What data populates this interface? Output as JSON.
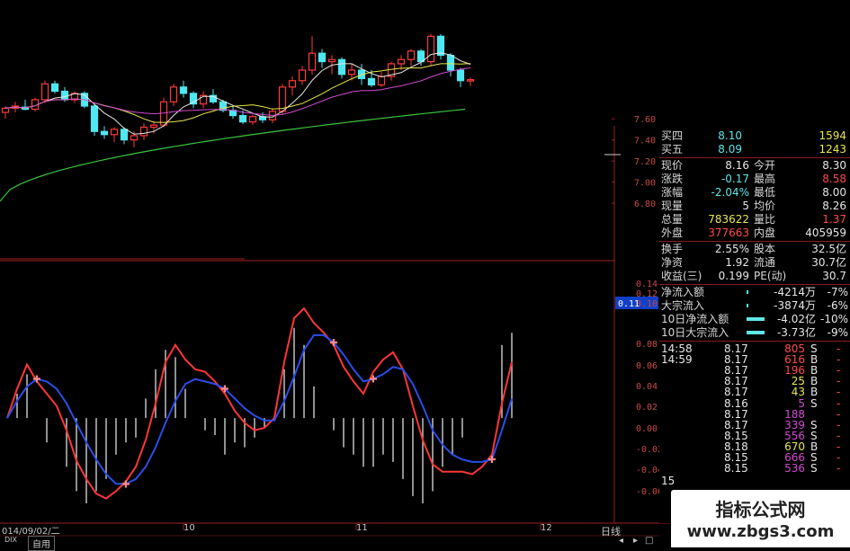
{
  "chart_data": [
    {
      "type": "candlestick",
      "title": "",
      "ylim": [
        6.7,
        8.4
      ],
      "y_ticks": [
        "7.60",
        "7.40",
        "7.20",
        "7.00",
        "6.80"
      ],
      "up_color": "#ff3b3b",
      "down_color": "#4fe8f2",
      "ma_colors": [
        "#e8e8e8",
        "#e8e84a",
        "#d24ad2",
        "#3cc43c"
      ],
      "candles": [
        {
          "o": 7.66,
          "h": 7.72,
          "l": 7.6,
          "c": 7.7
        },
        {
          "o": 7.7,
          "h": 7.76,
          "l": 7.66,
          "c": 7.72
        },
        {
          "o": 7.71,
          "h": 7.78,
          "l": 7.68,
          "c": 7.69
        },
        {
          "o": 7.69,
          "h": 7.8,
          "l": 7.67,
          "c": 7.78
        },
        {
          "o": 7.78,
          "h": 7.96,
          "l": 7.75,
          "c": 7.93
        },
        {
          "o": 7.93,
          "h": 7.96,
          "l": 7.84,
          "c": 7.86
        },
        {
          "o": 7.86,
          "h": 7.9,
          "l": 7.76,
          "c": 7.78
        },
        {
          "o": 7.78,
          "h": 7.86,
          "l": 7.75,
          "c": 7.84
        },
        {
          "o": 7.84,
          "h": 7.86,
          "l": 7.7,
          "c": 7.72
        },
        {
          "o": 7.72,
          "h": 7.74,
          "l": 7.44,
          "c": 7.48
        },
        {
          "o": 7.48,
          "h": 7.53,
          "l": 7.41,
          "c": 7.45
        },
        {
          "o": 7.45,
          "h": 7.52,
          "l": 7.38,
          "c": 7.5
        },
        {
          "o": 7.5,
          "h": 7.52,
          "l": 7.36,
          "c": 7.4
        },
        {
          "o": 7.4,
          "h": 7.48,
          "l": 7.33,
          "c": 7.44
        },
        {
          "o": 7.44,
          "h": 7.56,
          "l": 7.4,
          "c": 7.52
        },
        {
          "o": 7.52,
          "h": 7.58,
          "l": 7.46,
          "c": 7.54
        },
        {
          "o": 7.54,
          "h": 7.8,
          "l": 7.52,
          "c": 7.76
        },
        {
          "o": 7.76,
          "h": 7.93,
          "l": 7.72,
          "c": 7.9
        },
        {
          "o": 7.9,
          "h": 7.96,
          "l": 7.8,
          "c": 7.84
        },
        {
          "o": 7.84,
          "h": 7.86,
          "l": 7.7,
          "c": 7.74
        },
        {
          "o": 7.74,
          "h": 7.86,
          "l": 7.7,
          "c": 7.82
        },
        {
          "o": 7.82,
          "h": 7.88,
          "l": 7.74,
          "c": 7.76
        },
        {
          "o": 7.76,
          "h": 7.78,
          "l": 7.66,
          "c": 7.68
        },
        {
          "o": 7.68,
          "h": 7.72,
          "l": 7.6,
          "c": 7.63
        },
        {
          "o": 7.63,
          "h": 7.68,
          "l": 7.55,
          "c": 7.57
        },
        {
          "o": 7.57,
          "h": 7.64,
          "l": 7.54,
          "c": 7.62
        },
        {
          "o": 7.62,
          "h": 7.66,
          "l": 7.56,
          "c": 7.59
        },
        {
          "o": 7.59,
          "h": 7.7,
          "l": 7.56,
          "c": 7.67
        },
        {
          "o": 7.67,
          "h": 7.93,
          "l": 7.64,
          "c": 7.9
        },
        {
          "o": 7.9,
          "h": 8.0,
          "l": 7.82,
          "c": 7.96
        },
        {
          "o": 7.96,
          "h": 8.1,
          "l": 7.92,
          "c": 8.06
        },
        {
          "o": 8.06,
          "h": 8.38,
          "l": 8.02,
          "c": 8.22
        },
        {
          "o": 8.22,
          "h": 8.26,
          "l": 8.08,
          "c": 8.14
        },
        {
          "o": 8.14,
          "h": 8.2,
          "l": 8.02,
          "c": 8.16
        },
        {
          "o": 8.16,
          "h": 8.18,
          "l": 7.98,
          "c": 8.02
        },
        {
          "o": 8.02,
          "h": 8.12,
          "l": 7.96,
          "c": 8.06
        },
        {
          "o": 8.06,
          "h": 8.12,
          "l": 7.92,
          "c": 7.98
        },
        {
          "o": 7.98,
          "h": 8.06,
          "l": 7.9,
          "c": 7.92
        },
        {
          "o": 7.92,
          "h": 8.04,
          "l": 7.9,
          "c": 8.0
        },
        {
          "o": 8.0,
          "h": 8.14,
          "l": 7.96,
          "c": 8.12
        },
        {
          "o": 8.12,
          "h": 8.2,
          "l": 8.06,
          "c": 8.16
        },
        {
          "o": 8.16,
          "h": 8.26,
          "l": 8.1,
          "c": 8.24
        },
        {
          "o": 8.24,
          "h": 8.26,
          "l": 8.1,
          "c": 8.14
        },
        {
          "o": 8.14,
          "h": 8.4,
          "l": 8.1,
          "c": 8.38
        },
        {
          "o": 8.38,
          "h": 8.4,
          "l": 8.16,
          "c": 8.2
        },
        {
          "o": 8.2,
          "h": 8.22,
          "l": 8.0,
          "c": 8.06
        },
        {
          "o": 8.06,
          "h": 8.08,
          "l": 7.9,
          "c": 7.96
        },
        {
          "o": 7.96,
          "h": 7.99,
          "l": 7.91,
          "c": 7.97
        }
      ]
    },
    {
      "type": "line",
      "title": "",
      "ylim": [
        -0.07,
        0.11
      ],
      "y_ticks": [
        "0.14",
        "0.12",
        "0.11",
        "0.10",
        "0.08",
        "0.06",
        "0.04",
        "0.02",
        "0.00",
        "-0.02",
        "-0.04",
        "-0.06"
      ],
      "series": [
        {
          "color": "#ff3636",
          "values": [
            0.0,
            0.024,
            0.044,
            0.03,
            0.02,
            0.01,
            -0.01,
            -0.035,
            -0.05,
            -0.062,
            -0.066,
            -0.06,
            -0.052,
            -0.04,
            -0.018,
            0.012,
            0.046,
            0.06,
            0.048,
            0.04,
            0.038,
            0.03,
            0.02,
            0.006,
            -0.004,
            -0.01,
            -0.008,
            0.0,
            0.046,
            0.082,
            0.09,
            0.078,
            0.07,
            0.06,
            0.042,
            0.03,
            0.02,
            0.038,
            0.048,
            0.054,
            0.04,
            0.01,
            -0.018,
            -0.038,
            -0.044,
            -0.044,
            -0.044,
            -0.046,
            -0.04,
            -0.03,
            0.012,
            0.046
          ]
        },
        {
          "color": "#2a4ee8",
          "values": [
            0.0,
            0.014,
            0.026,
            0.032,
            0.03,
            0.024,
            0.012,
            -0.004,
            -0.02,
            -0.034,
            -0.046,
            -0.054,
            -0.054,
            -0.05,
            -0.04,
            -0.024,
            -0.004,
            0.014,
            0.028,
            0.032,
            0.03,
            0.028,
            0.024,
            0.016,
            0.008,
            0.002,
            -0.002,
            -0.002,
            0.014,
            0.034,
            0.056,
            0.068,
            0.068,
            0.062,
            0.052,
            0.04,
            0.03,
            0.032,
            0.036,
            0.042,
            0.04,
            0.028,
            0.01,
            -0.01,
            -0.022,
            -0.03,
            -0.034,
            -0.036,
            -0.036,
            -0.034,
            -0.01,
            0.016
          ]
        }
      ],
      "histogram": [
        0.0,
        0.02,
        0.036,
        0.0,
        -0.02,
        0.0,
        -0.04,
        -0.06,
        -0.07,
        -0.06,
        -0.05,
        -0.03,
        -0.02,
        -0.016,
        0.016,
        0.04,
        0.056,
        0.05,
        0.024,
        0.0,
        -0.01,
        -0.014,
        -0.03,
        -0.02,
        -0.024,
        -0.016,
        -0.008,
        0.0,
        0.04,
        0.074,
        0.06,
        0.026,
        0.0,
        -0.01,
        -0.024,
        -0.03,
        -0.04,
        -0.04,
        -0.03,
        -0.036,
        -0.05,
        -0.064,
        -0.07,
        -0.06,
        -0.04,
        -0.03,
        -0.016,
        0.0,
        0.0,
        0.0,
        0.06,
        0.07
      ]
    }
  ],
  "x_labels": [
    "014/09/02/二",
    "10",
    "11",
    "12"
  ],
  "bottom_tabs": [
    "DIX",
    "自用"
  ],
  "bottom_right_label": "日线",
  "highlight_value": "0.11",
  "panel": {
    "order_book": [
      {
        "label": "买四",
        "price": "8.10",
        "vol": "1594"
      },
      {
        "label": "买五",
        "price": "8.09",
        "vol": "1243"
      }
    ],
    "quote_rows": [
      {
        "l1": "现价",
        "v1": "8.16",
        "l2": "今开",
        "v2": "8.30"
      },
      {
        "l1": "涨跌",
        "v1": "-0.17",
        "l2": "最高",
        "v2": "8.58"
      },
      {
        "l1": "涨幅",
        "v1": "-2.04%",
        "l2": "最低",
        "v2": "8.00"
      },
      {
        "l1": "现量",
        "v1": "5",
        "l2": "均价",
        "v2": "8.26"
      },
      {
        "l1": "总量",
        "v1": "783622",
        "l2": "量比",
        "v2": "1.37"
      },
      {
        "l1": "外盘",
        "v1": "377663",
        "l2": "内盘",
        "v2": "405959"
      }
    ],
    "stats_rows": [
      {
        "l1": "换手",
        "v1": "2.55%",
        "l2": "股本",
        "v2": "32.5亿"
      },
      {
        "l1": "净资",
        "v1": "1.92",
        "l2": "流通",
        "v2": "30.7亿"
      },
      {
        "l1": "收益(三)",
        "v1": "0.199",
        "l2": "PE(动)",
        "v2": "30.7"
      }
    ],
    "flow_rows": [
      {
        "label": "净流入额",
        "value": "-4214万",
        "pct": "-7%"
      },
      {
        "label": "大宗流入",
        "value": "-3874万",
        "pct": "-6%"
      },
      {
        "label": "10日净流入额",
        "value": "-4.02亿",
        "pct": "-10%"
      },
      {
        "label": "10日大宗流入",
        "value": "-3.73亿",
        "pct": "-9%"
      }
    ],
    "ticks": [
      {
        "time": "14:58",
        "price": "8.17",
        "vol": "805",
        "side": "S"
      },
      {
        "time": "14:59",
        "price": "8.17",
        "vol": "616",
        "side": "B"
      },
      {
        "time": "",
        "price": "8.17",
        "vol": "196",
        "side": "B"
      },
      {
        "time": "",
        "price": "8.17",
        "vol": "25",
        "side": "B"
      },
      {
        "time": "",
        "price": "8.17",
        "vol": "43",
        "side": "B"
      },
      {
        "time": "",
        "price": "8.16",
        "vol": "5",
        "side": "S"
      },
      {
        "time": "",
        "price": "8.17",
        "vol": "188",
        "side": ""
      },
      {
        "time": "",
        "price": "8.17",
        "vol": "339",
        "side": "S"
      },
      {
        "time": "",
        "price": "8.15",
        "vol": "556",
        "side": "S"
      },
      {
        "time": "",
        "price": "8.18",
        "vol": "670",
        "side": "B"
      },
      {
        "time": "",
        "price": "8.15",
        "vol": "666",
        "side": "S"
      },
      {
        "time": "",
        "price": "8.15",
        "vol": "536",
        "side": "S"
      }
    ],
    "footer_time": "15"
  },
  "watermark": {
    "title": "指标公式网",
    "url": "www.zbgs3.com"
  }
}
